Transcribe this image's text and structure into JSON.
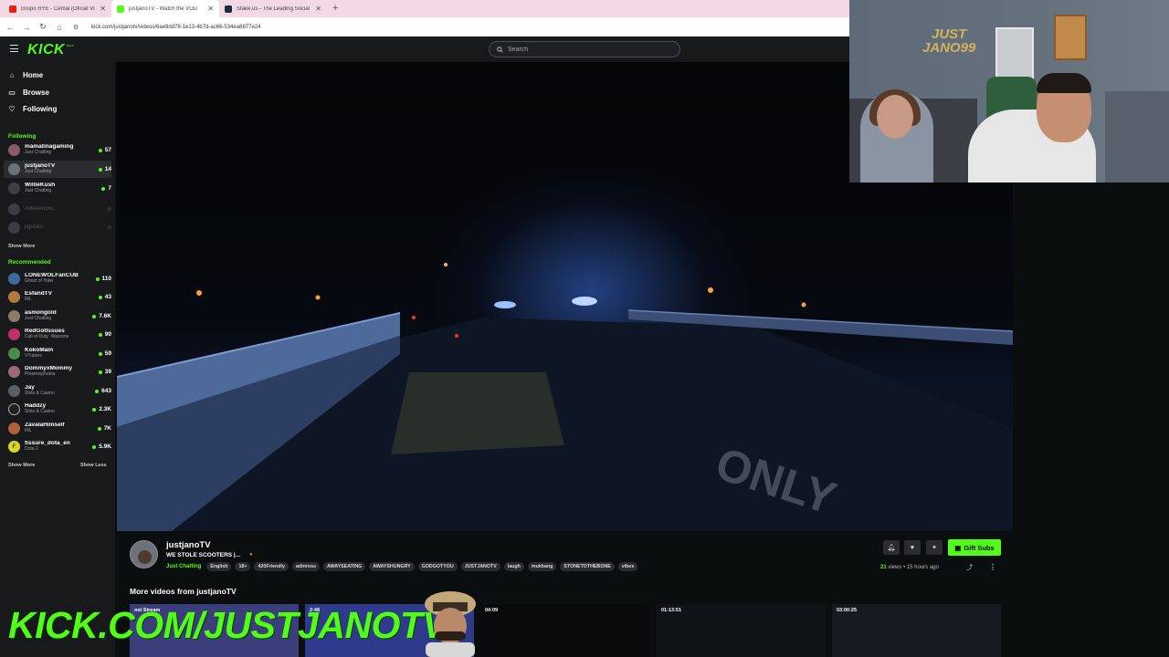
{
  "browser": {
    "tabs": [
      {
        "label": "Grupo RYE - Cemal (Oficial Vid",
        "favicon_color": "#e62117"
      },
      {
        "label": "justjanoTV - Watch the VOD",
        "favicon_color": "#53fc18"
      },
      {
        "label": "Stake.us - The Leading Social C",
        "favicon_color": "#1a2c38"
      }
    ],
    "new_tab": "+",
    "url": "kick.com/justjanotv/videos/6ae9dd78-1e13-4b7d-ac66-534ea8877e24"
  },
  "header": {
    "logo": "KICK",
    "logo_badge": "BETA",
    "search_placeholder": "Search"
  },
  "sidebar": {
    "nav": [
      {
        "label": "Home",
        "icon": "home-icon"
      },
      {
        "label": "Browse",
        "icon": "browse-icon"
      },
      {
        "label": "Following",
        "icon": "heart-icon"
      }
    ],
    "following_title": "Following",
    "following": [
      {
        "name": "mamatinagaming",
        "category": "Just Chatting",
        "viewers": "57",
        "online": true
      },
      {
        "name": "justjanoTV",
        "category": "Just Chatting",
        "viewers": "14",
        "online": true
      },
      {
        "name": "WillieKush",
        "category": "Just Chatting",
        "viewers": "7",
        "online": true
      },
      {
        "name": "Adleamonc",
        "category": "",
        "viewers": "",
        "online": false
      },
      {
        "name": "jigstats",
        "category": "",
        "viewers": "",
        "online": false
      }
    ],
    "following_show_more": "Show More",
    "recommended_title": "Recommended",
    "recommended": [
      {
        "name": "LONEWOLFanCUB",
        "category": "Ghost of Yotei",
        "viewers": "110"
      },
      {
        "name": "EsfandTV",
        "category": "IRL",
        "viewers": "43"
      },
      {
        "name": "asmongold",
        "category": "Just Chatting",
        "viewers": "7.6K"
      },
      {
        "name": "RedGotIssues",
        "category": "Call of Duty: Warzone",
        "viewers": "90"
      },
      {
        "name": "KokoMain",
        "category": "VTubers",
        "viewers": "59"
      },
      {
        "name": "DommyxMommy",
        "category": "Phasmophobia",
        "viewers": "39"
      },
      {
        "name": "Jay",
        "category": "Slots & Casino",
        "viewers": "643"
      },
      {
        "name": "Haddzy",
        "category": "Slots & Casino",
        "viewers": "2.3K"
      },
      {
        "name": "ZavalaHimself",
        "category": "IRL",
        "viewers": "7K"
      },
      {
        "name": "fissure_dota_en",
        "category": "Dota 2",
        "viewers": "5.9K"
      }
    ],
    "recommended_show_more": "Show More",
    "recommended_show_less": "Show Less"
  },
  "video_info": {
    "channel": "justjanoTV",
    "title": "WE STOLE SCOOTERS |...",
    "category": "Just Chatting",
    "tags": [
      "English",
      "18+",
      "420Friendly",
      "adinross",
      "AWAYSEATING",
      "AWAYSHUNGRY",
      "GODGOTYOU",
      "JUSTJANOTV",
      "laugh",
      "mukbang",
      "STONETOTHEBONE",
      "vibes"
    ],
    "gift_label": "Gift Subs",
    "views_count": "21",
    "views_label": "views",
    "separator": "•",
    "posted": "15 hours ago"
  },
  "more_videos": {
    "title": "More videos from justjanoTV",
    "items": [
      {
        "duration": "",
        "label": "ost Stream"
      },
      {
        "duration": "2:48",
        "label": ""
      },
      {
        "duration": "04:09",
        "label": ""
      },
      {
        "duration": "01:13:51",
        "label": ""
      },
      {
        "duration": "03:00:25",
        "label": ""
      }
    ]
  },
  "webcam": {
    "logo_line1": "JUST",
    "logo_line2": "JANO99"
  },
  "overlay_text": "KICK.COM/JUSTJANOTV",
  "colors": {
    "accent": "#53fc18",
    "bg": "#0b0e0f",
    "sidebar": "#18191b"
  }
}
